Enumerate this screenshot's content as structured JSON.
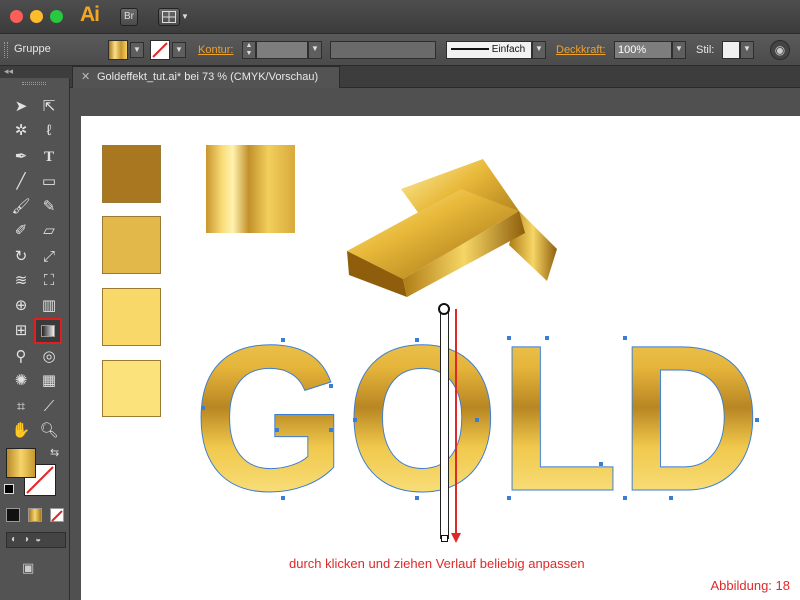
{
  "app": {
    "name": "Ai",
    "bridge_label": "Br"
  },
  "colors": {
    "accent": "#f5a623",
    "caption": "#e02828",
    "gold_dark": "#a9771f",
    "gold_mid": "#e2b84a",
    "gold_light": "#f9d86a",
    "gold_pale": "#fbe27a",
    "anchor": "#3a7dd4"
  },
  "control_bar": {
    "selection_label": "Gruppe",
    "stroke_label": "Kontur:",
    "stroke_style": "Einfach",
    "opacity_label": "Deckkraft:",
    "opacity_value": "100%",
    "style_label": "Stil:"
  },
  "document_tab": {
    "title": "Goldeffekt_tut.ai* bei 73 % (CMYK/Vorschau)"
  },
  "canvas": {
    "headline": "GOLD",
    "caption": "durch klicken und ziehen Verlauf beliebig anpassen",
    "figure_label": "Abbildung: 18"
  },
  "tools": [
    "selection-tool",
    "direct-selection-tool",
    "magic-wand-tool",
    "lasso-tool",
    "pen-tool",
    "type-tool",
    "line-tool",
    "rectangle-tool",
    "paintbrush-tool",
    "pencil-tool",
    "blob-brush-tool",
    "eraser-tool",
    "rotate-tool",
    "scale-tool",
    "warp-tool",
    "free-transform-tool",
    "shape-builder-tool",
    "graph-tool",
    "mesh-tool",
    "gradient-tool",
    "eyedropper-tool",
    "blend-tool",
    "symbol-sprayer-tool",
    "slice-tool",
    "artboard-tool",
    "knife-tool",
    "hand-tool",
    "zoom-tool"
  ]
}
